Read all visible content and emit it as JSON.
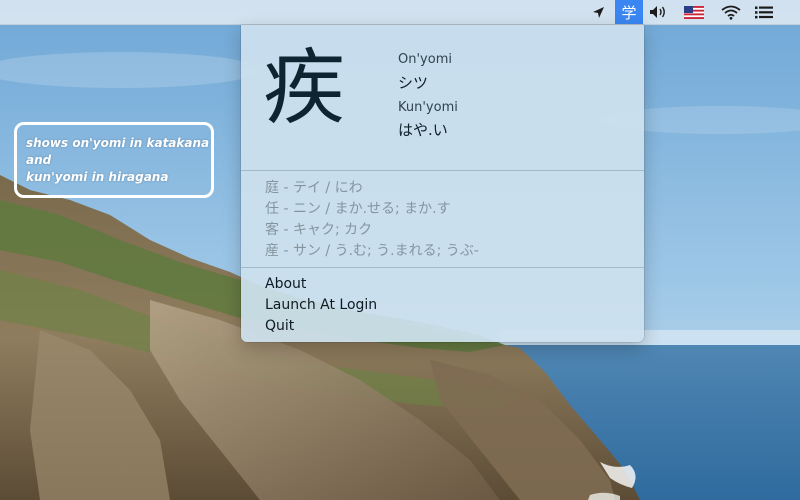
{
  "menubar": {
    "app_icon_text": "学",
    "items": [
      {
        "icon": "location-arrow-icon"
      },
      {
        "icon": "kanji-app-icon"
      },
      {
        "icon": "volume-icon"
      },
      {
        "icon": "us-flag-icon"
      },
      {
        "icon": "wifi-icon"
      },
      {
        "icon": "list-menu-icon"
      }
    ],
    "accent_color": "#3a86f2"
  },
  "callout": {
    "lines": [
      "shows on'yomi in katakana",
      "and",
      "kun'yomi in hiragana"
    ]
  },
  "popover": {
    "kanji": "疾",
    "onyomi_label": "On'yomi",
    "onyomi_value": "シツ",
    "kunyomi_label": "Kun'yomi",
    "kunyomi_value": "はや.い",
    "related": [
      "庭 - テイ / にわ",
      "任 - ニン / まか.せる; まか.す",
      "客 - キャク; カク",
      "産 - サン / う.む; う.まれる; うぶ-"
    ],
    "menu_items": [
      "About",
      "Launch At Login",
      "Quit"
    ]
  }
}
